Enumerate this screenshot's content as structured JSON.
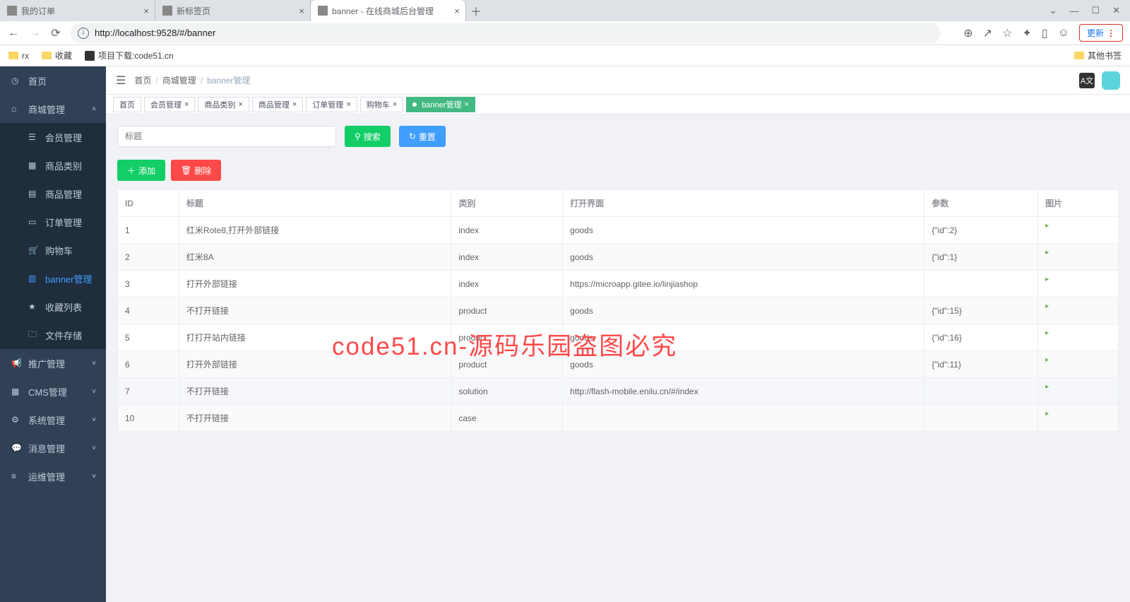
{
  "browser": {
    "tabs": [
      {
        "label": "我的订单"
      },
      {
        "label": "新标签页"
      },
      {
        "label": "banner - 在线商城后台管理",
        "active": true
      }
    ],
    "newtab": "＋",
    "window": {
      "chevron": "⌄",
      "min": "—",
      "max": "☐",
      "close": "✕"
    },
    "url": "http://localhost:9528/#/banner",
    "update": "更新",
    "bookmarks": {
      "items": [
        "rx",
        "收藏",
        "项目下载:code51.cn"
      ],
      "other": "其他书签"
    }
  },
  "sidebar": {
    "top": [
      {
        "icon": "◷",
        "label": "首页"
      },
      {
        "icon": "⌂",
        "label": "商城管理",
        "arrow": "˄",
        "expanded": true
      }
    ],
    "sub": [
      {
        "icon": "☰",
        "label": "会员管理"
      },
      {
        "icon": "▦",
        "label": "商品类别"
      },
      {
        "icon": "▤",
        "label": "商品管理"
      },
      {
        "icon": "▭",
        "label": "订单管理"
      },
      {
        "icon": "🛒",
        "label": "购物车"
      },
      {
        "icon": "▥",
        "label": "banner管理",
        "active": true
      },
      {
        "icon": "★",
        "label": "收藏列表"
      },
      {
        "icon": "🗀",
        "label": "文件存储"
      }
    ],
    "bottom": [
      {
        "icon": "📢",
        "label": "推广管理",
        "arrow": "˅"
      },
      {
        "icon": "▦",
        "label": "CMS管理",
        "arrow": "˅"
      },
      {
        "icon": "⚙",
        "label": "系统管理",
        "arrow": "˅"
      },
      {
        "icon": "💬",
        "label": "消息管理",
        "arrow": "˅"
      },
      {
        "icon": "≡",
        "label": "运维管理",
        "arrow": "˅"
      }
    ]
  },
  "topbar": {
    "breadcrumb": [
      "首页",
      "商城管理",
      "banner管理"
    ],
    "lang": "A文"
  },
  "tags": [
    {
      "label": "首页"
    },
    {
      "label": "会员管理",
      "close": true
    },
    {
      "label": "商品类别",
      "close": true
    },
    {
      "label": "商品管理",
      "close": true
    },
    {
      "label": "订单管理",
      "close": true
    },
    {
      "label": "购物车",
      "close": true
    },
    {
      "label": "banner管理",
      "close": true,
      "active": true
    }
  ],
  "search": {
    "placeholder": "标题",
    "btn_search": "搜索",
    "btn_reset": "重置"
  },
  "actions": {
    "add": "添加",
    "delete": "删除"
  },
  "table": {
    "headers": [
      "ID",
      "标题",
      "类别",
      "打开界面",
      "参数",
      "图片"
    ],
    "rows": [
      {
        "id": "1",
        "title": "红米Rote8,打开外部链接",
        "cat": "index",
        "open": "goods",
        "param": "{\"id\":2}"
      },
      {
        "id": "2",
        "title": "红米8A",
        "cat": "index",
        "open": "goods",
        "param": "{\"id\":1}"
      },
      {
        "id": "3",
        "title": "打开外部链接",
        "cat": "index",
        "open": "https://microapp.gitee.io/linjiashop",
        "param": ""
      },
      {
        "id": "4",
        "title": "不打开链接",
        "cat": "product",
        "open": "goods",
        "param": "{\"id\":15}"
      },
      {
        "id": "5",
        "title": "打打开站内链接",
        "cat": "product",
        "open": "goods",
        "param": "{\"id\":16}"
      },
      {
        "id": "6",
        "title": "打开外部链接",
        "cat": "product",
        "open": "goods",
        "param": "{\"id\":11}"
      },
      {
        "id": "7",
        "title": "不打开链接",
        "cat": "solution",
        "open": "http://flash-mobile.enilu.cn/#/index",
        "param": "",
        "highlight": true
      },
      {
        "id": "10",
        "title": "不打开链接",
        "cat": "case",
        "open": "",
        "param": ""
      }
    ]
  },
  "watermark": "code51.cn-源码乐园盗图必究"
}
